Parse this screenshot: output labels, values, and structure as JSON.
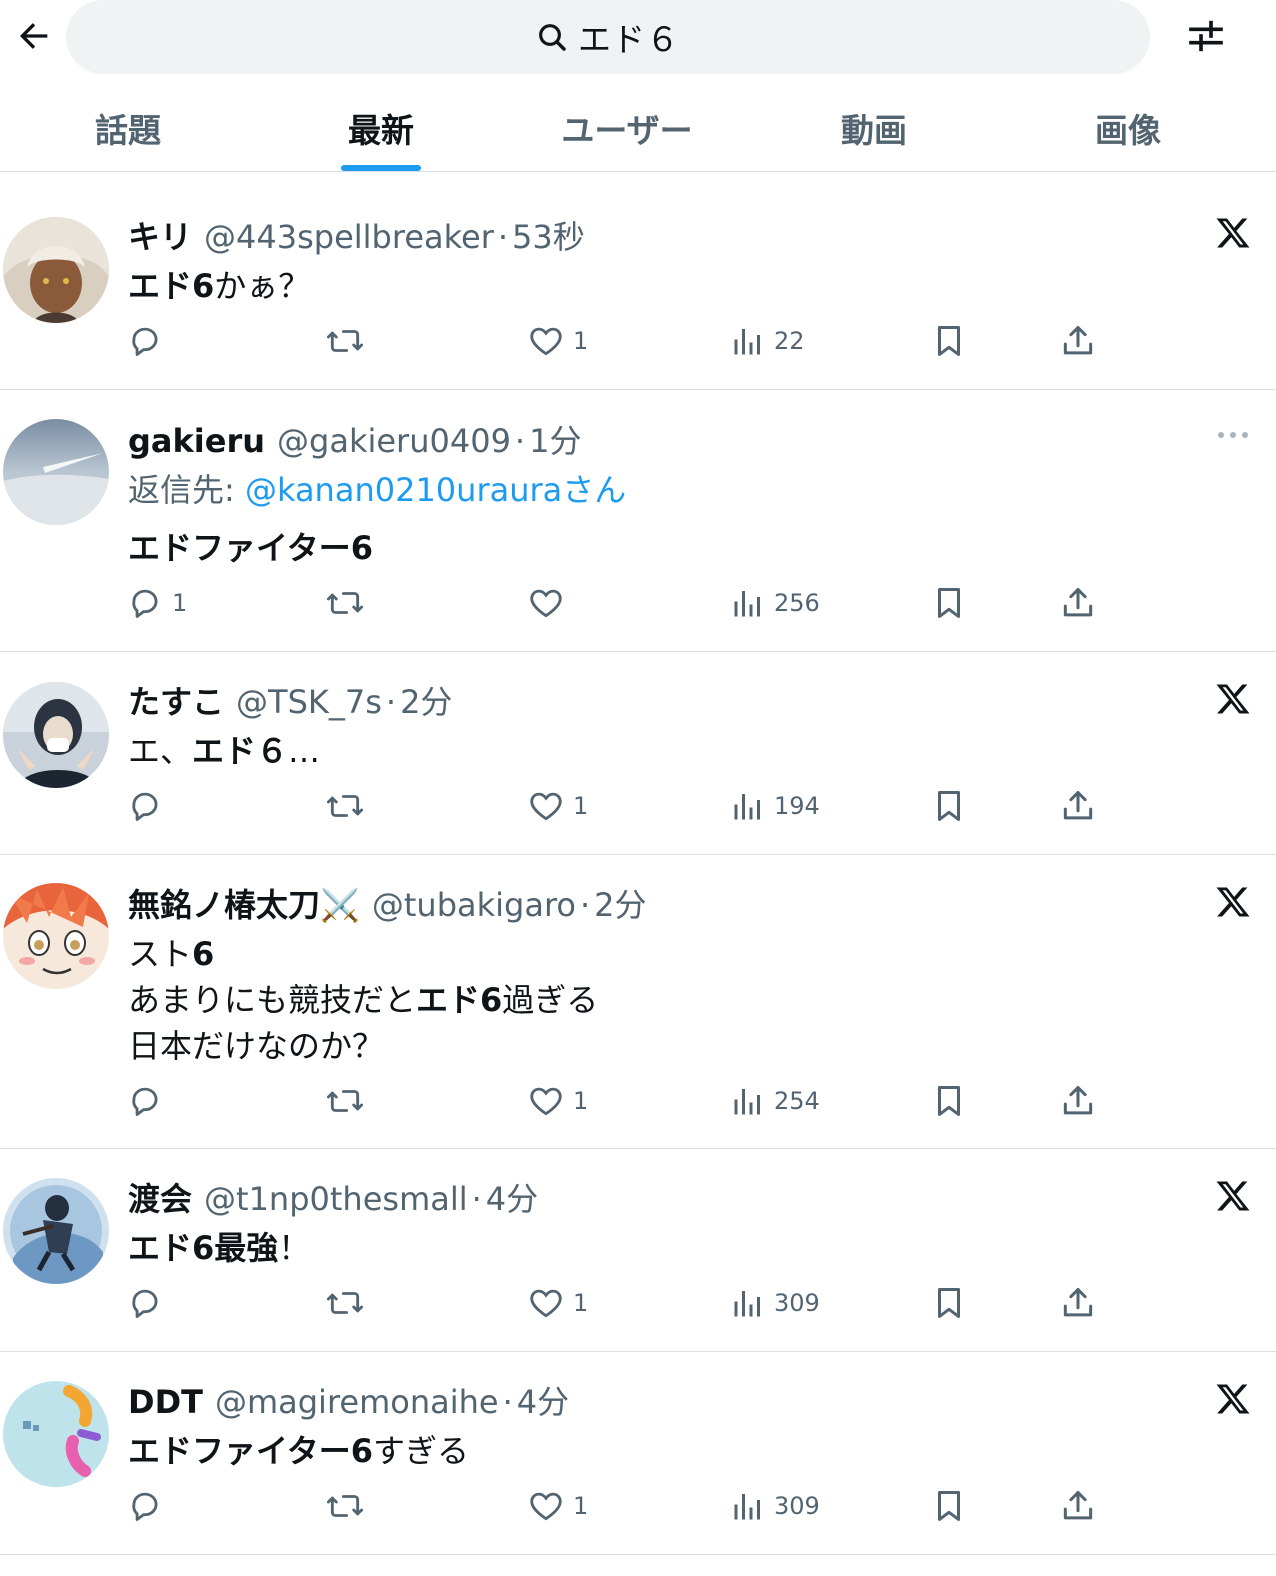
{
  "search": {
    "query": "エド６"
  },
  "tabs": [
    {
      "label": "話題"
    },
    {
      "label": "最新"
    },
    {
      "label": "ユーザー"
    },
    {
      "label": "動画"
    },
    {
      "label": "画像"
    }
  ],
  "active_tab": "最新",
  "colors": {
    "accent": "#1d9bf0",
    "muted_text": "#536471",
    "primary_text": "#0f1419",
    "search_bg": "#eff3f4"
  },
  "posts": [
    {
      "name": "キリ",
      "handle": "@443spellbreaker",
      "dot": "·",
      "time": "53秒",
      "text_bold": "エド6",
      "text_rest": "かぁ？",
      "replies": "",
      "likes": "1",
      "views": "22",
      "corner_icon": "x-logo-icon"
    },
    {
      "name": "gakieru",
      "handle": "@gakieru0409",
      "dot": "·",
      "time": "1分",
      "reply_prefix": "返信先: ",
      "reply_mention": "@kanan0210uraura",
      "reply_suffix": "さん",
      "text_bold": "エドファイター6",
      "replies": "1",
      "likes": "",
      "views": "256",
      "corner_icon": "more-icon"
    },
    {
      "name": "たすこ",
      "handle": "@TSK_7s",
      "dot": "·",
      "time": "2分",
      "text_pre": "エ、",
      "text_bold": "エド６",
      "text_rest": "…",
      "replies": "",
      "likes": "1",
      "views": "194",
      "corner_icon": "x-logo-icon"
    },
    {
      "name": "無銘ノ椿太刀⚔️",
      "handle": "@tubakigaro",
      "dot": "·",
      "time": "2分",
      "line1_pre": "スト",
      "line1_bold": "6",
      "line2_pre": "あまりにも競技だと",
      "line2_bold": "エド6",
      "line2_rest": "過ぎる",
      "line3": "日本だけなのか？",
      "replies": "",
      "likes": "1",
      "views": "254",
      "corner_icon": "x-logo-icon"
    },
    {
      "name": "渡会",
      "handle": "@t1np0thesmall",
      "dot": "·",
      "time": "4分",
      "text_bold": "エド6最強",
      "text_rest": "！",
      "replies": "",
      "likes": "1",
      "views": "309",
      "corner_icon": "x-logo-icon"
    },
    {
      "name": "DDT",
      "handle": "@magiremonaihe",
      "dot": "·",
      "time": "4分",
      "text_bold": "エドファイター6",
      "text_rest": "すぎる",
      "replies": "",
      "likes": "1",
      "views": "309",
      "corner_icon": "x-logo-icon"
    }
  ]
}
